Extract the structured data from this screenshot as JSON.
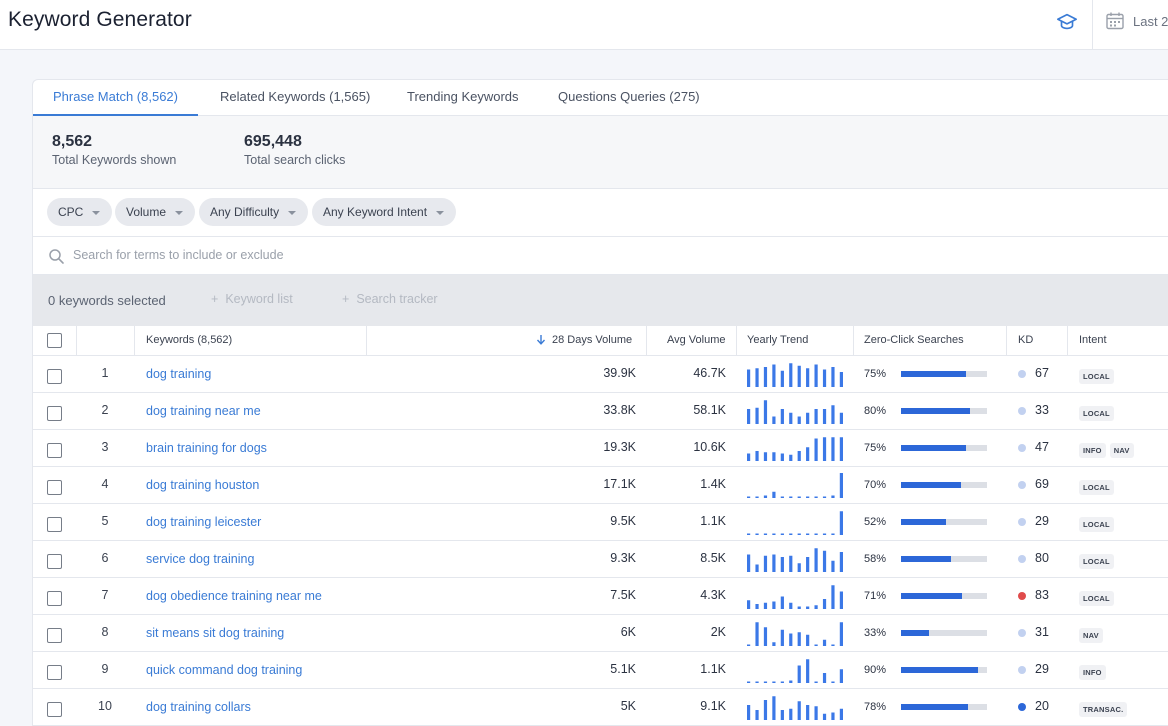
{
  "header": {
    "title": "Keyword Generator",
    "date_label": "Last 2"
  },
  "tabs": [
    {
      "label": "Phrase Match (8,562)",
      "active": true
    },
    {
      "label": "Related Keywords (1,565)",
      "active": false
    },
    {
      "label": "Trending Keywords",
      "active": false
    },
    {
      "label": "Questions Queries (275)",
      "active": false
    }
  ],
  "summary": {
    "total_keywords": {
      "value": "8,562",
      "label": "Total Keywords shown"
    },
    "total_clicks": {
      "value": "695,448",
      "label": "Total search clicks"
    }
  },
  "filters": [
    "CPC",
    "Volume",
    "Any Difficulty",
    "Any Keyword Intent"
  ],
  "search": {
    "placeholder": "Search for terms to include or exclude",
    "value": ""
  },
  "selection": {
    "count_label": "0 keywords selected",
    "keyword_list_label": "Keyword list",
    "search_tracker_label": "Search tracker"
  },
  "table": {
    "headers": {
      "keywords": "Keywords (8,562)",
      "volume_28": "28 Days Volume",
      "avg_volume": "Avg Volume",
      "yearly_trend": "Yearly Trend",
      "zero_click": "Zero-Click Searches",
      "kd": "KD",
      "intent": "Intent"
    },
    "colors": {
      "trend_bar": "#3b78e7",
      "zero_click_fill": "#2c67d8",
      "kd_light": "#c2d1f0",
      "kd_red": "#e04b4b",
      "kd_blue": "#2c67d8"
    },
    "rows": [
      {
        "n": "1",
        "keyword": "dog training",
        "vol28": "39.9K",
        "avg": "46.7K",
        "trend": [
          0.7,
          0.75,
          0.8,
          0.9,
          0.65,
          0.95,
          0.85,
          0.75,
          0.9,
          0.7,
          0.8,
          0.6
        ],
        "zc": "75%",
        "zc_value": 0.75,
        "kd": "67",
        "kd_color": "#c2d1f0",
        "intent": [
          "LOCAL"
        ]
      },
      {
        "n": "2",
        "keyword": "dog training near me",
        "vol28": "33.8K",
        "avg": "58.1K",
        "trend": [
          0.6,
          0.65,
          0.95,
          0.3,
          0.6,
          0.45,
          0.3,
          0.45,
          0.6,
          0.6,
          0.75,
          0.45
        ],
        "zc": "80%",
        "zc_value": 0.8,
        "kd": "33",
        "kd_color": "#c2d1f0",
        "intent": [
          "LOCAL"
        ]
      },
      {
        "n": "3",
        "keyword": "brain training for dogs",
        "vol28": "19.3K",
        "avg": "10.6K",
        "trend": [
          0.3,
          0.4,
          0.35,
          0.35,
          0.3,
          0.25,
          0.4,
          0.55,
          0.9,
          0.95,
          0.95,
          0.95
        ],
        "zc": "75%",
        "zc_value": 0.75,
        "kd": "47",
        "kd_color": "#c2d1f0",
        "intent": [
          "INFO",
          "NAV"
        ]
      },
      {
        "n": "4",
        "keyword": "dog training houston",
        "vol28": "17.1K",
        "avg": "1.4K",
        "trend": [
          0.06,
          0.06,
          0.1,
          0.25,
          0.06,
          0.06,
          0.06,
          0.06,
          0.06,
          0.06,
          0.1,
          1.0
        ],
        "zc": "70%",
        "zc_value": 0.7,
        "kd": "69",
        "kd_color": "#c2d1f0",
        "intent": [
          "LOCAL"
        ]
      },
      {
        "n": "5",
        "keyword": "dog training leicester",
        "vol28": "9.5K",
        "avg": "1.1K",
        "trend": [
          0.04,
          0.04,
          0.04,
          0.04,
          0.04,
          0.04,
          0.04,
          0.04,
          0.04,
          0.04,
          0.06,
          0.95
        ],
        "zc": "52%",
        "zc_value": 0.52,
        "kd": "29",
        "kd_color": "#c2d1f0",
        "intent": [
          "LOCAL"
        ]
      },
      {
        "n": "6",
        "keyword": "service dog training",
        "vol28": "9.3K",
        "avg": "8.5K",
        "trend": [
          0.7,
          0.3,
          0.65,
          0.7,
          0.6,
          0.65,
          0.35,
          0.6,
          0.95,
          0.85,
          0.45,
          0.8
        ],
        "zc": "58%",
        "zc_value": 0.58,
        "kd": "80",
        "kd_color": "#c2d1f0",
        "intent": [
          "LOCAL"
        ]
      },
      {
        "n": "7",
        "keyword": "dog obedience training near me",
        "vol28": "7.5K",
        "avg": "4.3K",
        "trend": [
          0.35,
          0.2,
          0.25,
          0.3,
          0.5,
          0.25,
          0.1,
          0.1,
          0.15,
          0.4,
          0.95,
          0.7
        ],
        "zc": "71%",
        "zc_value": 0.71,
        "kd": "83",
        "kd_color": "#e04b4b",
        "intent": [
          "LOCAL"
        ]
      },
      {
        "n": "8",
        "keyword": "sit means sit dog training",
        "vol28": "6K",
        "avg": "2K",
        "trend": [
          0.06,
          0.95,
          0.75,
          0.15,
          0.65,
          0.5,
          0.55,
          0.45,
          0.05,
          0.25,
          0.05,
          0.95
        ],
        "zc": "33%",
        "zc_value": 0.33,
        "kd": "31",
        "kd_color": "#c2d1f0",
        "intent": [
          "NAV"
        ]
      },
      {
        "n": "9",
        "keyword": "quick command dog training",
        "vol28": "5.1K",
        "avg": "1.1K",
        "trend": [
          0.05,
          0.05,
          0.05,
          0.05,
          0.05,
          0.1,
          0.7,
          0.95,
          0.05,
          0.4,
          0.05,
          0.55
        ],
        "zc": "90%",
        "zc_value": 0.9,
        "kd": "29",
        "kd_color": "#c2d1f0",
        "intent": [
          "INFO"
        ]
      },
      {
        "n": "10",
        "keyword": "dog training collars",
        "vol28": "5K",
        "avg": "9.1K",
        "trend": [
          0.6,
          0.4,
          0.8,
          0.95,
          0.4,
          0.45,
          0.75,
          0.6,
          0.55,
          0.25,
          0.3,
          0.45
        ],
        "zc": "78%",
        "zc_value": 0.78,
        "kd": "20",
        "kd_color": "#2c67d8",
        "intent": [
          "TRANSAC."
        ]
      }
    ]
  }
}
